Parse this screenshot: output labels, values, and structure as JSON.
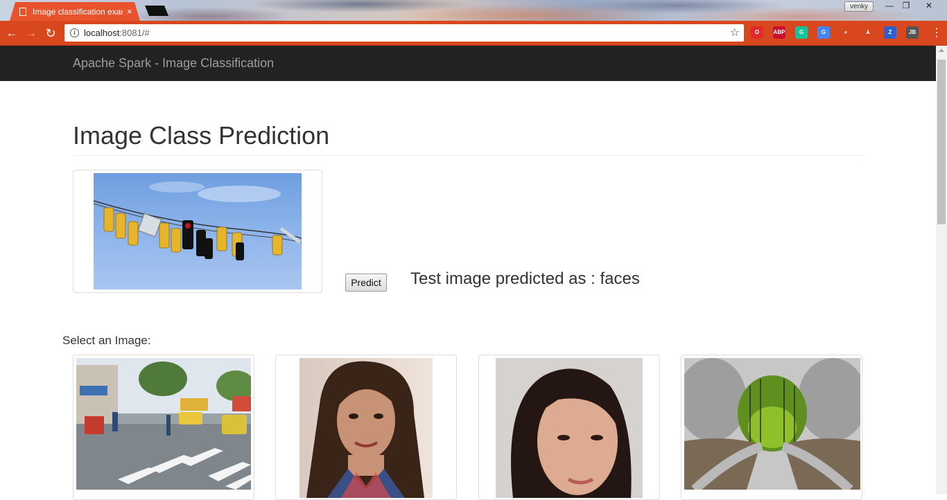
{
  "browser": {
    "tab_title": "Image classification exam",
    "tab_close": "×",
    "user_name": "venky",
    "window_controls": {
      "minimize": "—",
      "maximize": "❐",
      "close": "✕"
    },
    "nav": {
      "back": "←",
      "forward": "→",
      "reload": "↻"
    },
    "info_glyph": "i",
    "url_host": "localhost",
    "url_rest": ":8081/#",
    "star": "☆",
    "extensions": [
      {
        "name": "opera-extension-icon",
        "label": "O",
        "color": "#e02b2b"
      },
      {
        "name": "adblock-plus-icon",
        "label": "ABP",
        "color": "#c8102e"
      },
      {
        "name": "grammarly-icon",
        "label": "G",
        "color": "#15c39a"
      },
      {
        "name": "google-translate-icon",
        "label": "G",
        "color": "#4285f4"
      },
      {
        "name": "search-extension-icon",
        "label": "⌕",
        "color": "#d9471f"
      },
      {
        "name": "pdf-extension-icon",
        "label": "⅄",
        "color": "#d9471f"
      },
      {
        "name": "zotero-icon",
        "label": "Z",
        "color": "#2f5fcf"
      },
      {
        "name": "jetbrains-icon",
        "label": "JB",
        "color": "#555555"
      }
    ],
    "menu": "⋮"
  },
  "navbar": {
    "brand": "Apache Spark - Image Classification"
  },
  "main": {
    "title": "Image Class Prediction",
    "predict_label": "Predict",
    "result_text": "Test image predicted as : faces",
    "select_label": "Select an Image:"
  },
  "gallery": [
    {
      "name": "street-scene-image"
    },
    {
      "name": "woman-portrait-image-1"
    },
    {
      "name": "woman-portrait-image-2"
    },
    {
      "name": "forest-road-image"
    }
  ],
  "colors": {
    "navbar_bg": "#222222",
    "brand_text": "#9d9d9d",
    "chrome_accent": "#d9471f"
  }
}
